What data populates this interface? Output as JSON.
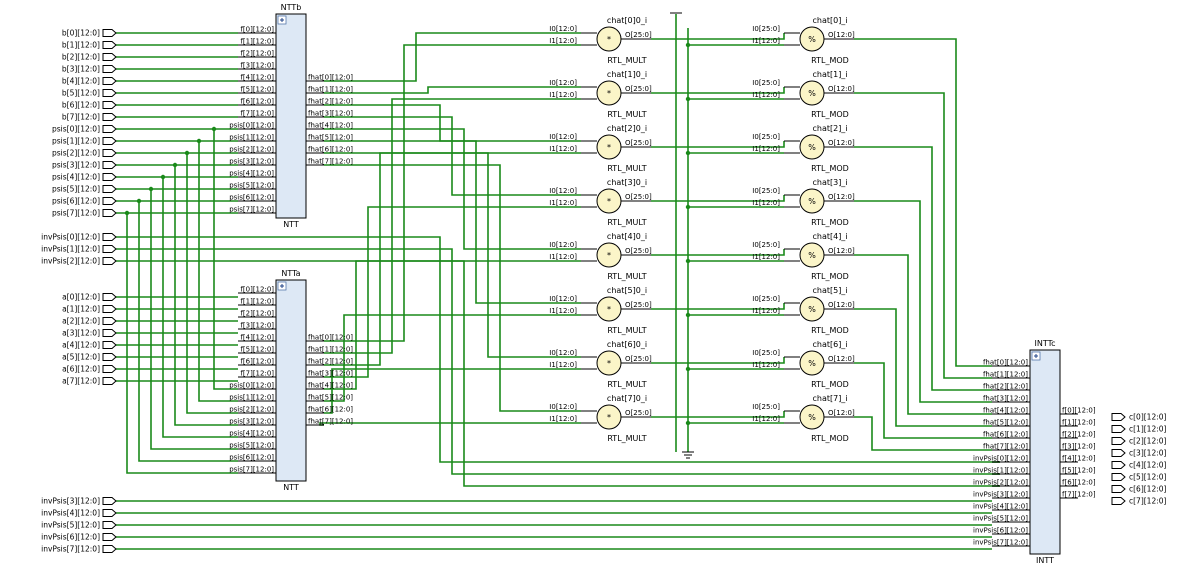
{
  "inputs": {
    "b": [
      "b[0][12:0]",
      "b[1][12:0]",
      "b[2][12:0]",
      "b[3][12:0]",
      "b[4][12:0]",
      "b[5][12:0]",
      "b[6][12:0]",
      "b[7][12:0]"
    ],
    "psis": [
      "psis[0][12:0]",
      "psis[1][12:0]",
      "psis[2][12:0]",
      "psis[3][12:0]",
      "psis[4][12:0]",
      "psis[5][12:0]",
      "psis[6][12:0]",
      "psis[7][12:0]"
    ],
    "invPsis_top": [
      "invPsis[0][12:0]",
      "invPsis[1][12:0]",
      "invPsis[2][12:0]"
    ],
    "a": [
      "a[0][12:0]",
      "a[1][12:0]",
      "a[2][12:0]",
      "a[3][12:0]",
      "a[4][12:0]",
      "a[5][12:0]",
      "a[6][12:0]",
      "a[7][12:0]"
    ],
    "invPsis_bottom": [
      "invPsis[3][12:0]",
      "invPsis[4][12:0]",
      "invPsis[5][12:0]",
      "invPsis[6][12:0]",
      "invPsis[7][12:0]"
    ]
  },
  "outputs": [
    "c[0][12:0]",
    "c[1][12:0]",
    "c[2][12:0]",
    "c[3][12:0]",
    "c[4][12:0]",
    "c[5][12:0]",
    "c[6][12:0]",
    "c[7][12:0]"
  ],
  "blocks": {
    "nttb": {
      "instance": "NTTb",
      "module": "NTT",
      "in_pins": [
        "f[0][12:0]",
        "f[1][12:0]",
        "f[2][12:0]",
        "f[3][12:0]",
        "f[4][12:0]",
        "f[5][12:0]",
        "f[6][12:0]",
        "f[7][12:0]",
        "psis[0][12:0]",
        "psis[1][12:0]",
        "psis[2][12:0]",
        "psis[3][12:0]",
        "psis[4][12:0]",
        "psis[5][12:0]",
        "psis[6][12:0]",
        "psis[7][12:0]"
      ],
      "out_pins": [
        "fhat[0][12:0]",
        "fhat[1][12:0]",
        "fhat[2][12:0]",
        "fhat[3][12:0]",
        "fhat[4][12:0]",
        "fhat[5][12:0]",
        "fhat[6][12:0]",
        "fhat[7][12:0]"
      ]
    },
    "ntta": {
      "instance": "NTTa",
      "module": "NTT",
      "in_pins": [
        "f[0][12:0]",
        "f[1][12:0]",
        "f[2][12:0]",
        "f[3][12:0]",
        "f[4][12:0]",
        "f[5][12:0]",
        "f[6][12:0]",
        "f[7][12:0]",
        "psis[0][12:0]",
        "psis[1][12:0]",
        "psis[2][12:0]",
        "psis[3][12:0]",
        "psis[4][12:0]",
        "psis[5][12:0]",
        "psis[6][12:0]",
        "psis[7][12:0]"
      ],
      "out_pins": [
        "fhat[0][12:0]",
        "fhat[1][12:0]",
        "fhat[2][12:0]",
        "fhat[3][12:0]",
        "fhat[4][12:0]",
        "fhat[5][12:0]",
        "fhat[6][12:0]",
        "fhat[7][12:0]"
      ]
    },
    "inttc": {
      "instance": "INTTc",
      "module": "INTT",
      "in_pins": [
        "fhat[0][12:0]",
        "fhat[1][12:0]",
        "fhat[2][12:0]",
        "fhat[3][12:0]",
        "fhat[4][12:0]",
        "fhat[5][12:0]",
        "fhat[6][12:0]",
        "fhat[7][12:0]",
        "invPsis[0][12:0]",
        "invPsis[1][12:0]",
        "invPsis[2][12:0]",
        "invPsis[3][12:0]",
        "invPsis[4][12:0]",
        "invPsis[5][12:0]",
        "invPsis[6][12:0]",
        "invPsis[7][12:0]"
      ],
      "out_pins": [
        "f[0][12:0]",
        "f[1][12:0]",
        "f[2][12:0]",
        "f[3][12:0]",
        "f[4][12:0]",
        "f[5][12:0]",
        "f[6][12:0]",
        "f[7][12:0]"
      ]
    }
  },
  "multipliers": {
    "names": [
      "chat[0]0_i",
      "chat[1]0_i",
      "chat[2]0_i",
      "chat[3]0_i",
      "chat[4]0_i",
      "chat[5]0_i",
      "chat[6]0_i",
      "chat[7]0_i"
    ],
    "type": "RTL_MULT",
    "symbol": "*",
    "pin_i0": "I0[12:0]",
    "pin_i1": "I1[12:0]",
    "pin_o": "O[25:0]"
  },
  "mods": {
    "names": [
      "chat[0]_i",
      "chat[1]_i",
      "chat[2]_i",
      "chat[3]_i",
      "chat[4]_i",
      "chat[5]_i",
      "chat[6]_i",
      "chat[7]_i"
    ],
    "type": "RTL_MOD",
    "symbol": "%",
    "pin_i0": "I0[25:0]",
    "pin_i1": "I1[12:0]",
    "pin_o": "O[12:0]"
  },
  "colors": {
    "wire": "#1a8a1a",
    "block_fill": "#dde8f5",
    "cell_fill": "#fbf5c8"
  },
  "icons": [
    "expand-icon",
    "ground-icon",
    "input-port-icon",
    "output-port-icon"
  ]
}
